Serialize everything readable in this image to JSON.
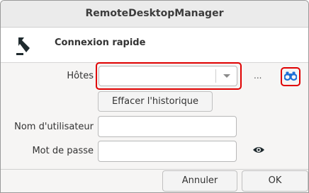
{
  "window": {
    "title": "RemoteDesktopManager"
  },
  "header": {
    "title": "Connexion rapide",
    "icon": "connect-arrow-icon"
  },
  "form": {
    "hosts_label": "Hôtes",
    "hosts_value": "",
    "more_label": "...",
    "clear_history_label": "Effacer l'historique",
    "username_label": "Nom d'utilisateur",
    "username_value": "",
    "password_label": "Mot de passe",
    "password_value": ""
  },
  "buttons": {
    "cancel_label": "Annuler",
    "ok_label": "OK"
  },
  "colors": {
    "highlight": "#e00000",
    "accent_blue": "#1d6fd6",
    "icon_dark": "#1f2a2e"
  }
}
